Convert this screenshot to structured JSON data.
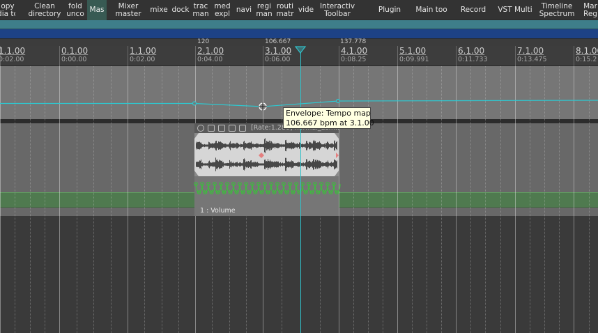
{
  "toolbar": {
    "items": [
      {
        "label": "opy\ndia to"
      },
      {
        "label": "Clean\ndirectory"
      },
      {
        "label": "fold\nunco"
      },
      {
        "label": "Mas",
        "active": true
      },
      {
        "label": "Mixer\nmaster"
      },
      {
        "label": "mixe"
      },
      {
        "label": "dock"
      },
      {
        "label": "trac\nman"
      },
      {
        "label": "med\nexpl"
      },
      {
        "label": "navi"
      },
      {
        "label": "regi\nman"
      },
      {
        "label": "routi\nmatr"
      },
      {
        "label": "vide"
      },
      {
        "label": "Interactiv\nToolbar"
      },
      {
        "label": "Plugin"
      },
      {
        "label": "Main too"
      },
      {
        "label": "Record"
      },
      {
        "label": "VST Multi"
      },
      {
        "label": "Timeline\nSpectrum"
      },
      {
        "label": "Mar\nReg"
      }
    ]
  },
  "tempo_markers": [
    "120",
    "106.667",
    "137.778"
  ],
  "ruler": {
    "bars": [
      "1.1.00",
      "0.1.00",
      "1.1.00",
      "2.1.00",
      "3.1.00",
      "4.1.00",
      "5.1.00",
      "6.1.00",
      "7.1.00",
      "8.1.00"
    ],
    "times": [
      "0:02.00",
      "0:00.00",
      "0:02.00",
      "0:04.00",
      "0:06.00",
      "0:08.25",
      "0:09.991",
      "0:11.733",
      "0:13.475",
      "0:15.2"
    ]
  },
  "item": {
    "header_text": "[Rate:1.280] normal_Lem...",
    "volume_label": "1 : Volume"
  },
  "tooltip": {
    "line1": "Envelope: Tempo map",
    "line2": "106.667 bpm at 3.1.00"
  },
  "colors": {
    "envelope": "#2ec8d0",
    "playhead": "#32c0c8",
    "volume_envelope": "#38c038",
    "track_selected": "#1d4286"
  }
}
